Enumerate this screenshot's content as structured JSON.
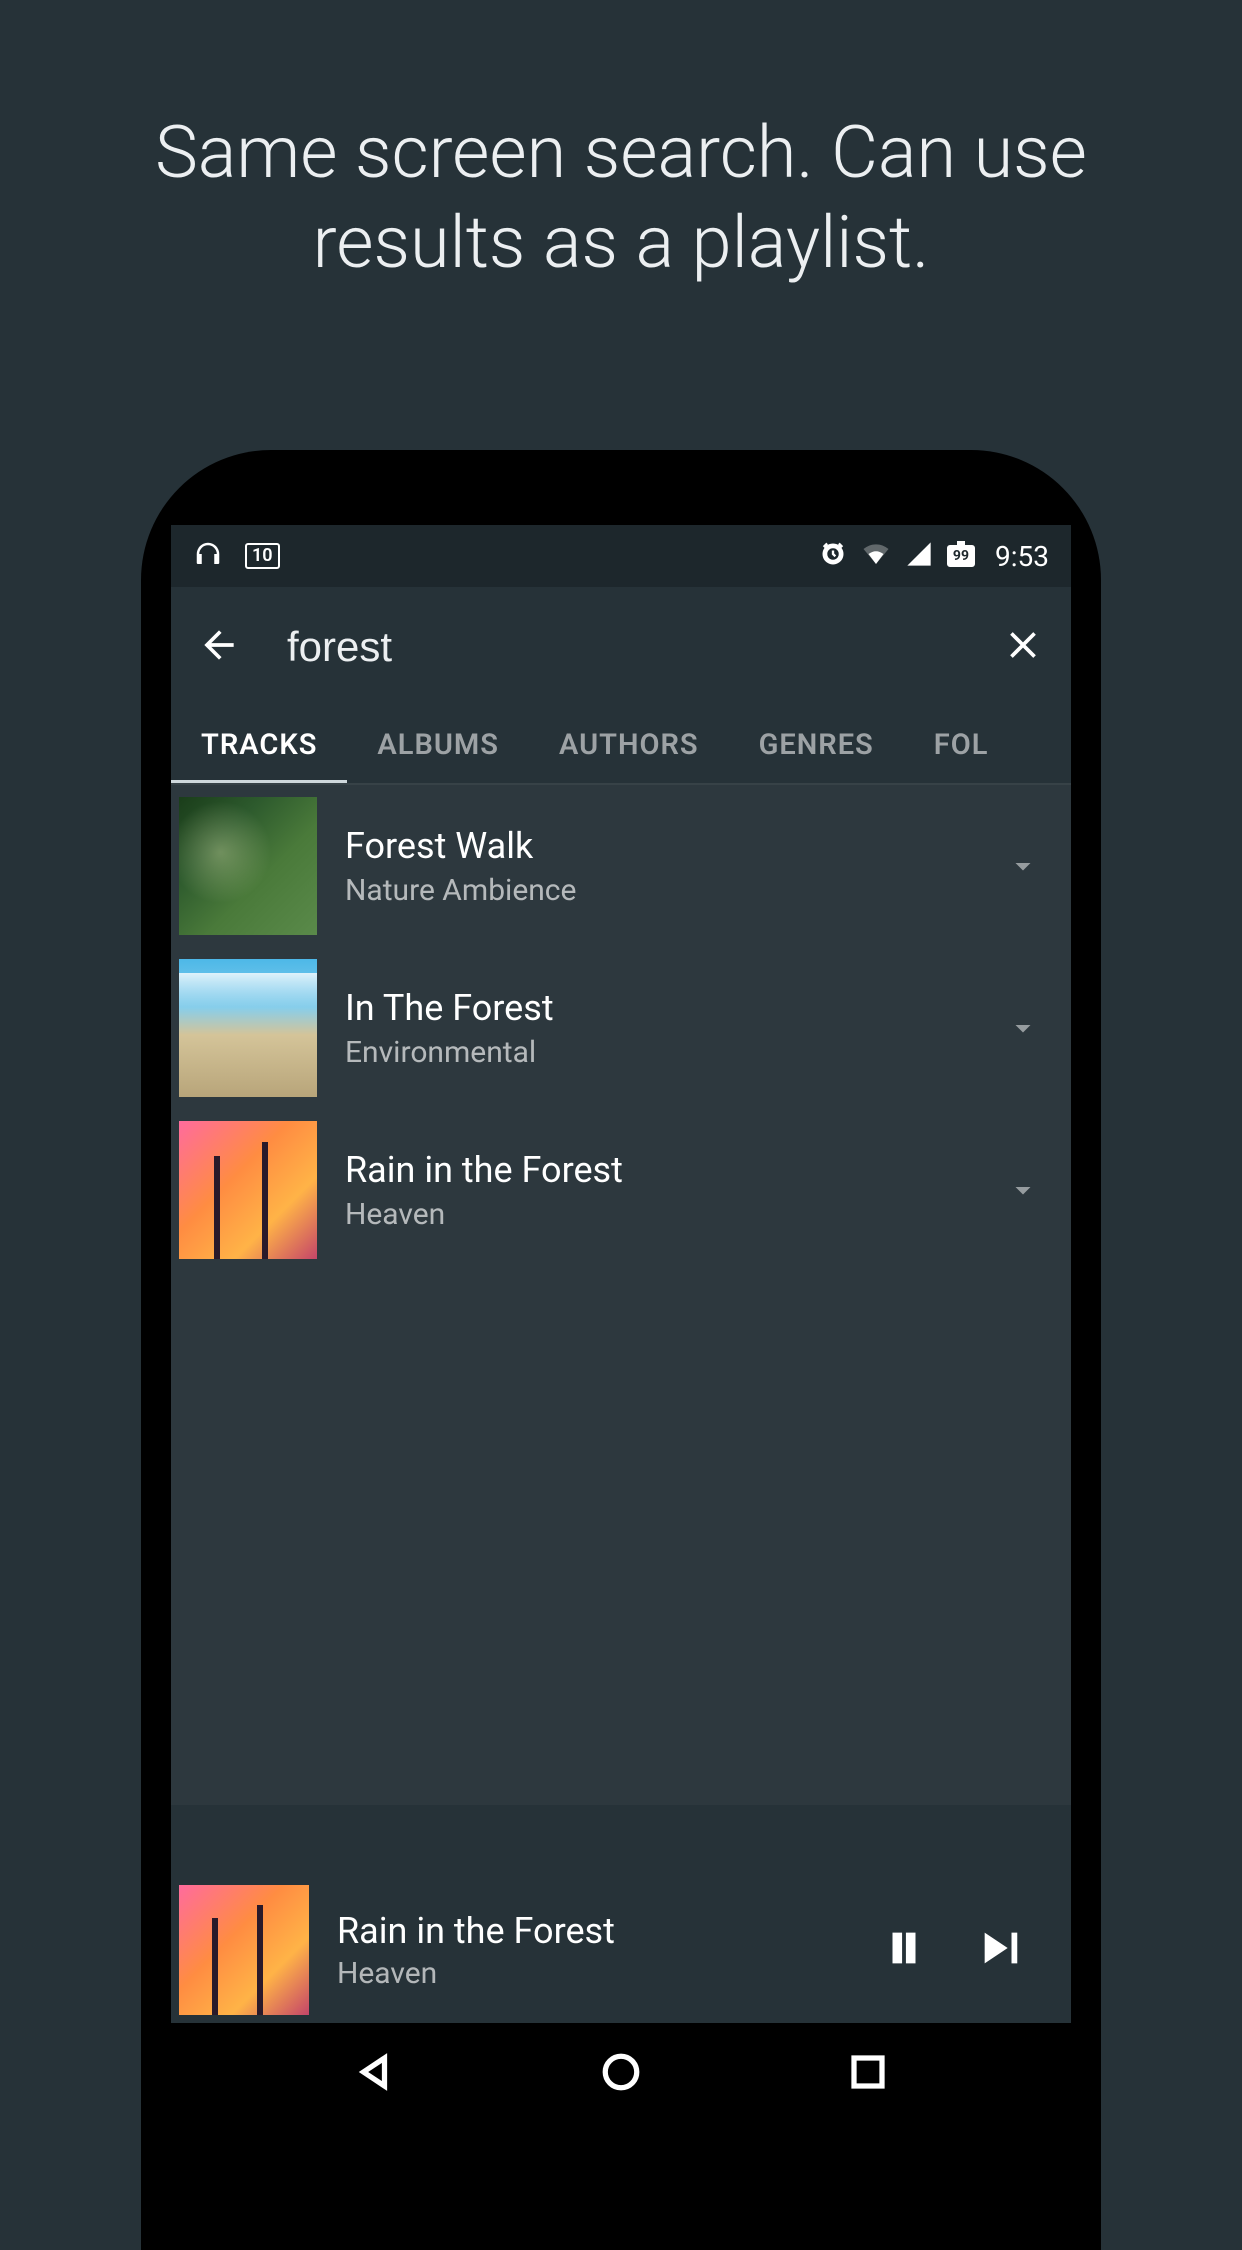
{
  "headline": "Same screen search. Can use results as a playlist.",
  "status": {
    "calendar_day": "10",
    "battery": "99",
    "time": "9:53"
  },
  "search": {
    "query": "forest"
  },
  "tabs": [
    {
      "label": "TRACKS",
      "active": true
    },
    {
      "label": "ALBUMS",
      "active": false
    },
    {
      "label": "AUTHORS",
      "active": false
    },
    {
      "label": "GENRES",
      "active": false
    },
    {
      "label": "FOL",
      "active": false
    }
  ],
  "tracks": [
    {
      "title": "Forest Walk",
      "artist": "Nature Ambience",
      "cover": "forest"
    },
    {
      "title": "In The Forest",
      "artist": "Environmental",
      "cover": "beach"
    },
    {
      "title": "Rain in the Forest",
      "artist": "Heaven",
      "cover": "palm"
    }
  ],
  "player": {
    "title": "Rain in the Forest",
    "artist": "Heaven",
    "cover": "palm"
  }
}
